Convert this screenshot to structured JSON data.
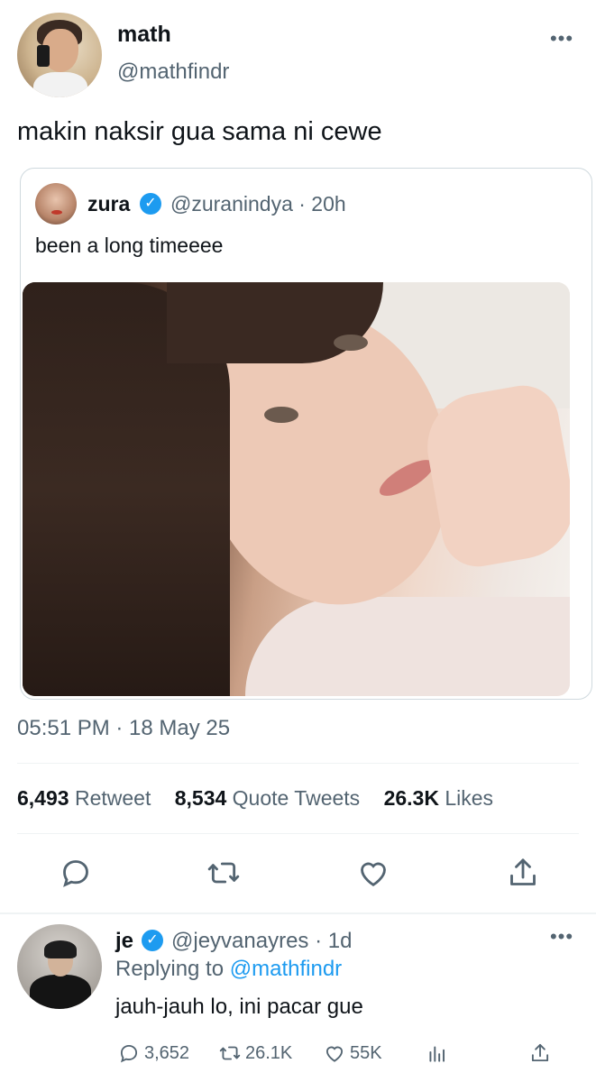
{
  "tweet": {
    "author_name": "math",
    "author_handle": "@mathfindr",
    "text": "makin naksir gua sama ni cewe",
    "timestamp": "05:51 PM · 18 May 25",
    "stats": {
      "retweets_count": "6,493",
      "retweets_label": "Retweet",
      "quotes_count": "8,534",
      "quotes_label": "Quote Tweets",
      "likes_count": "26.3K",
      "likes_label": "Likes"
    }
  },
  "quoted": {
    "author_name": "zura",
    "verified_glyph": "✓",
    "author_handle_time": "@zuranindya · 20h",
    "text": "been a long timeeee"
  },
  "more_glyph": "•••",
  "reply": {
    "author_name": "je",
    "verified_glyph": "✓",
    "author_handle_time": "@jeyvanayres · 1d",
    "replying_prefix": "Replying to ",
    "replying_handle": "@mathfindr",
    "text": "jauh-jauh lo, ini pacar gue",
    "actions": {
      "replies": "3,652",
      "retweets": "26.1K",
      "likes": "55K"
    }
  },
  "icons": {
    "reply": "reply-icon",
    "retweet": "retweet-icon",
    "like": "heart-icon",
    "share": "share-icon",
    "views": "views-icon",
    "more": "more-icon"
  },
  "colors": {
    "text": "#0f1419",
    "secondary": "#536471",
    "accent": "#1d9bf0",
    "border": "#cfd9de"
  }
}
